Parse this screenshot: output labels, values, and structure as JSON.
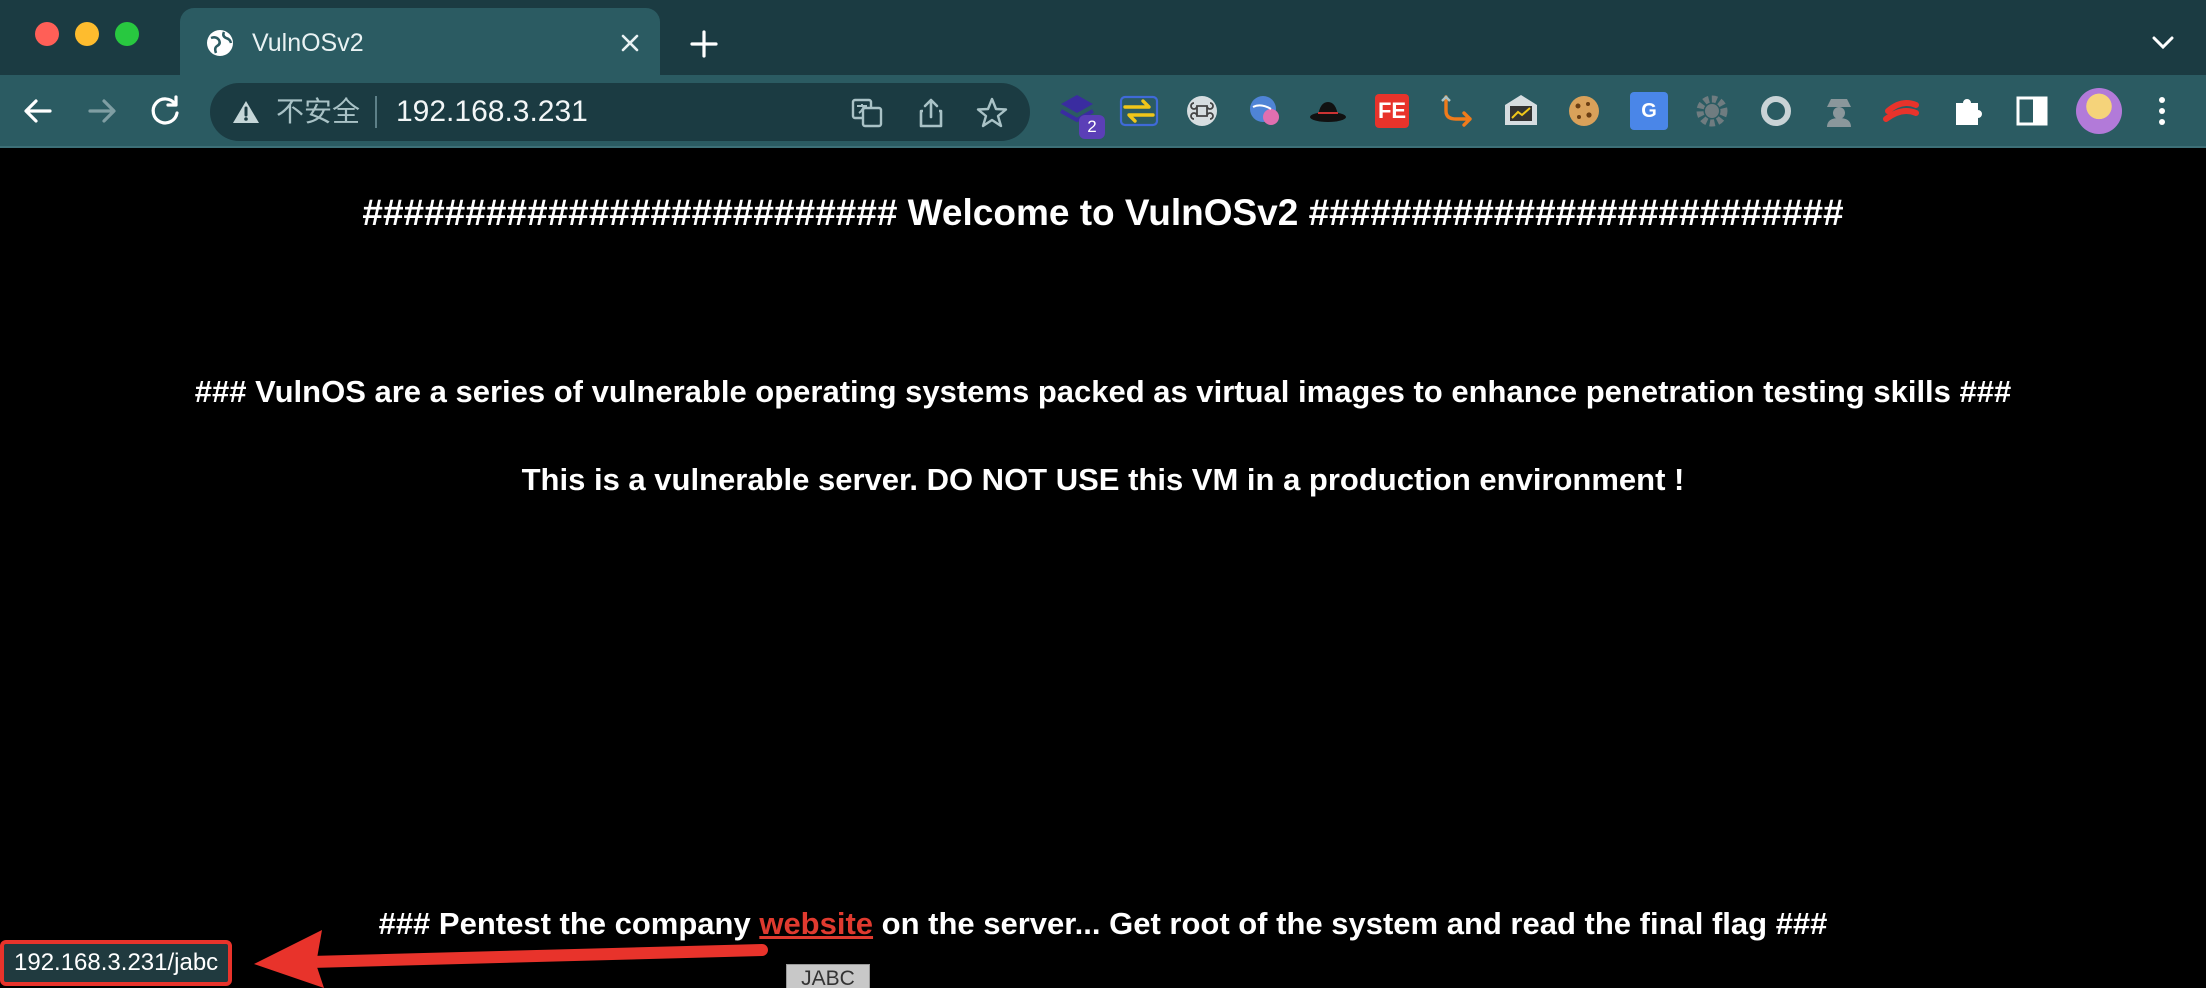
{
  "browser": {
    "tab": {
      "title": "VulnOSv2"
    },
    "address_bar": {
      "security_label": "不安全",
      "url": "192.168.3.231"
    },
    "extensions": [
      {
        "icon": "stacked-layers-icon",
        "badge": "2"
      },
      {
        "icon": "sync-arrows-icon"
      },
      {
        "icon": "command-key-icon"
      },
      {
        "icon": "globe-plugin-icon"
      },
      {
        "icon": "hat-icon"
      },
      {
        "icon": "fe-helper-icon",
        "label": "FE"
      },
      {
        "icon": "route-arrow-icon"
      },
      {
        "icon": "chart-screenshot-icon"
      },
      {
        "icon": "cookie-icon"
      },
      {
        "icon": "google-translate-icon",
        "label": "G"
      },
      {
        "icon": "gear-icon"
      },
      {
        "icon": "ring-icon"
      },
      {
        "icon": "spy-icon"
      },
      {
        "icon": "red-stripes-icon"
      },
      {
        "icon": "puzzle-icon"
      },
      {
        "icon": "side-panel-icon"
      }
    ],
    "colors": {
      "frame": "#1b3b42",
      "toolbar": "#2b5b62",
      "link": "#e03a2f",
      "highlight": "#e8332b"
    }
  },
  "page": {
    "welcome": "########################## Welcome to VulnOSv2 ##########################",
    "intro": "### VulnOS are a series of vulnerable operating systems packed as virtual images to enhance penetration testing skills ###",
    "warning": "This is a vulnerable server. DO NOT USE this VM in a production environment !",
    "pentest": {
      "before": "### Pentest the company ",
      "link": "website",
      "after": " on the server... Get root of the system and read the final flag ###"
    },
    "jabc_button": "JABC"
  },
  "status_bar": {
    "url": "192.168.3.231/jabc"
  }
}
